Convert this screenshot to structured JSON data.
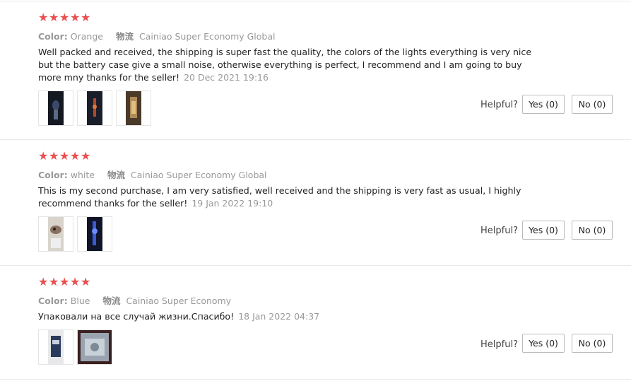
{
  "reviews": [
    {
      "rating": 5,
      "color_label": "Color:",
      "color_value": "Orange",
      "logistics_label": "物流",
      "logistics_value": "Cainiao Super Economy Global",
      "text": "Well packed and received, the shipping is super fast the quality, the colors of the lights everything is very nice but the battery case give a small noise, otherwise everything is perfect, I recommend and I am going to buy more mny thanks for the seller!",
      "date": "20 Dec 2021 19:16",
      "photos": [
        "photo-1",
        "photo-2",
        "photo-3"
      ],
      "helpful_label": "Helpful?",
      "yes_label": "Yes (0)",
      "no_label": "No (0)"
    },
    {
      "rating": 5,
      "color_label": "Color:",
      "color_value": "white",
      "logistics_label": "物流",
      "logistics_value": "Cainiao Super Economy Global",
      "text": "This is my second purchase, I am very satisfied, well received and the shipping is very fast as usual, I highly recommend thanks for the seller!",
      "date": "19 Jan 2022 19:10",
      "photos": [
        "photo-1",
        "photo-2"
      ],
      "helpful_label": "Helpful?",
      "yes_label": "Yes (0)",
      "no_label": "No (0)"
    },
    {
      "rating": 5,
      "color_label": "Color:",
      "color_value": "Blue",
      "logistics_label": "物流",
      "logistics_value": "Cainiao Super Economy",
      "text": "Упаковали на все случай жизни.Спасибо!",
      "date": "18 Jan 2022 04:37",
      "photos": [
        "photo-1",
        "photo-2"
      ],
      "helpful_label": "Helpful?",
      "yes_label": "Yes (0)",
      "no_label": "No (0)"
    }
  ],
  "colors": {
    "star": "#ea4f4f",
    "meta": "#999999",
    "divider": "#e8e8e8"
  }
}
